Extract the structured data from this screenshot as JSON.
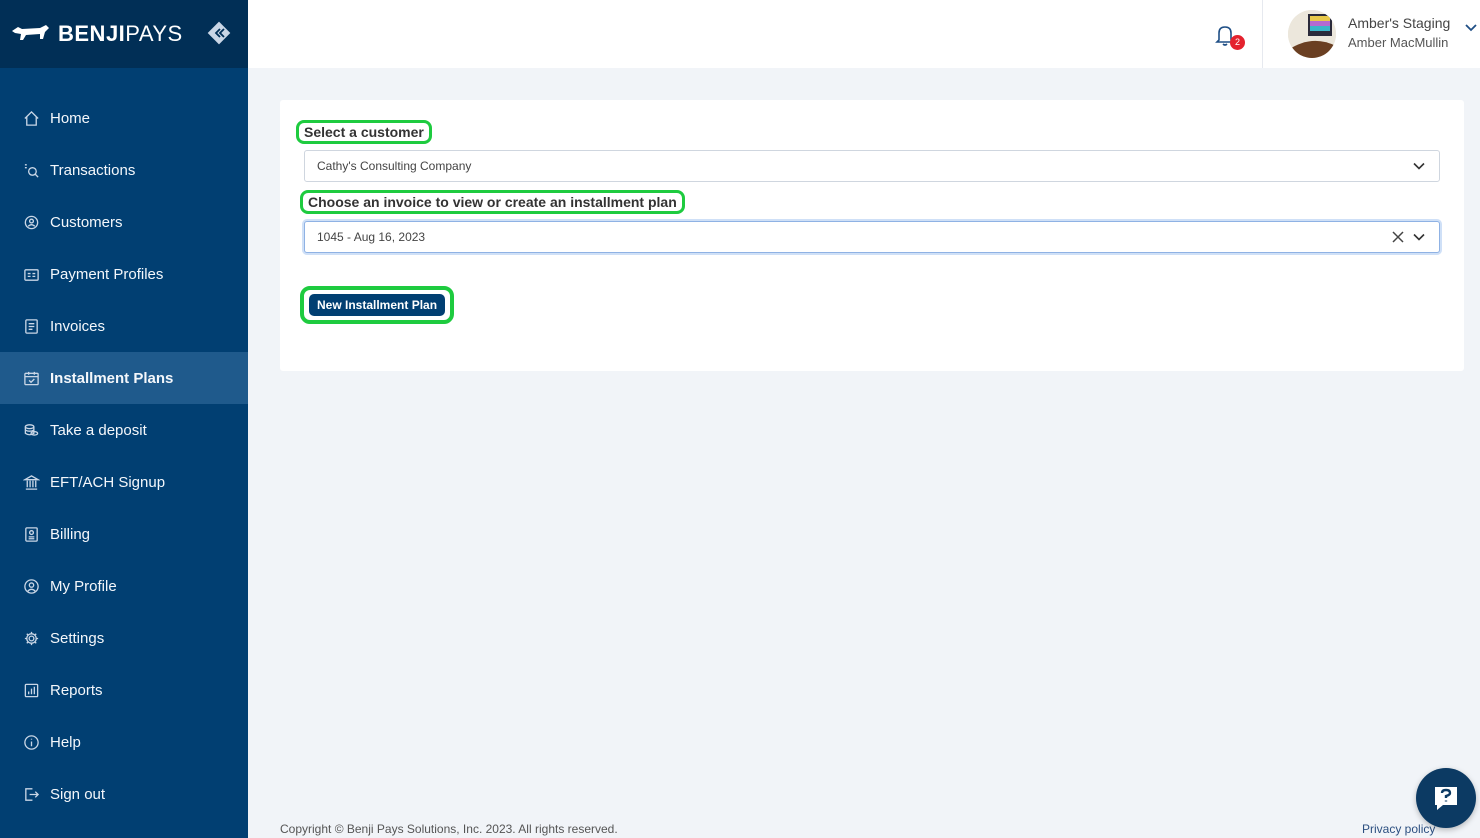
{
  "brand": {
    "name_bold": "BENJI",
    "name_light": "PAYS"
  },
  "sidebar": {
    "items": [
      {
        "label": "Home",
        "icon": "home-icon"
      },
      {
        "label": "Transactions",
        "icon": "search-icon"
      },
      {
        "label": "Customers",
        "icon": "customers-icon"
      },
      {
        "label": "Payment Profiles",
        "icon": "card-icon"
      },
      {
        "label": "Invoices",
        "icon": "invoice-icon"
      },
      {
        "label": "Installment Plans",
        "icon": "calendar-icon",
        "active": true
      },
      {
        "label": "Take a deposit",
        "icon": "coins-icon"
      },
      {
        "label": "EFT/ACH Signup",
        "icon": "bank-icon"
      },
      {
        "label": "Billing",
        "icon": "billing-icon"
      },
      {
        "label": "My Profile",
        "icon": "user-icon"
      },
      {
        "label": "Settings",
        "icon": "gear-icon"
      },
      {
        "label": "Reports",
        "icon": "reports-icon"
      },
      {
        "label": "Help",
        "icon": "info-icon"
      },
      {
        "label": "Sign out",
        "icon": "signout-icon"
      }
    ]
  },
  "header": {
    "notification_count": "2",
    "org_name": "Amber's Staging",
    "user_name": "Amber MacMullin"
  },
  "form": {
    "customer_label": "Select a customer",
    "customer_value": "Cathy's Consulting Company",
    "invoice_label": "Choose an invoice to view or create an installment plan",
    "invoice_value": "1045 - Aug 16, 2023",
    "new_plan_button": "New Installment Plan"
  },
  "footer": {
    "copyright": "Copyright © Benji Pays Solutions, Inc. 2023. All rights reserved.",
    "privacy": "Privacy policy"
  },
  "colors": {
    "sidebar": "#013f72",
    "brand_bar": "#012f56",
    "active_item": "#1f5a8c",
    "highlight": "#1ecb3f",
    "badge": "#e4222e"
  }
}
